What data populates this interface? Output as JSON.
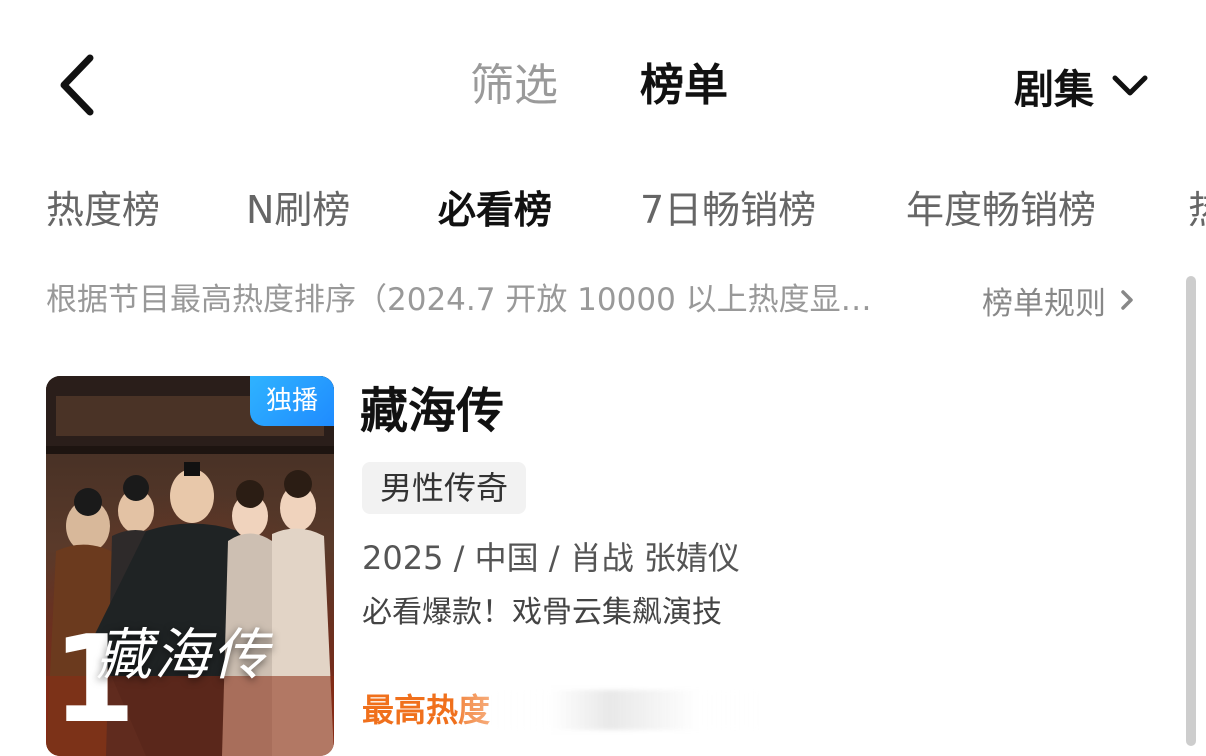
{
  "header": {
    "back_icon": "chevron-left-icon",
    "tabs": [
      {
        "label": "筛选",
        "active": false
      },
      {
        "label": "榜单",
        "active": true
      }
    ],
    "category": {
      "label": "剧集",
      "icon": "chevron-down-icon"
    }
  },
  "rank_tabs": [
    {
      "label": "热度榜",
      "active": false
    },
    {
      "label": "N刷榜",
      "active": false
    },
    {
      "label": "必看榜",
      "active": true
    },
    {
      "label": "7日畅销榜",
      "active": false
    },
    {
      "label": "年度畅销榜",
      "active": false
    },
    {
      "label": "热",
      "active": false
    }
  ],
  "info": {
    "text": "根据节目最高热度排序（2024.7 开放 10000 以上热度显…",
    "rules_label": "榜单规则",
    "rules_icon": "chevron-right-icon"
  },
  "items": [
    {
      "rank": "1",
      "badge": "独播",
      "poster_title": "藏海传",
      "title": "藏海传",
      "tag": "男性传奇",
      "meta": "2025 / 中国 / 肖战 张婧仪",
      "description": "必看爆款！戏骨云集飙演技",
      "hot_label": "最高热度"
    }
  ],
  "colors": {
    "accent_orange": "#f0701c",
    "badge_blue": "#1f8bff",
    "text_primary": "#111111",
    "text_secondary": "#999999"
  }
}
